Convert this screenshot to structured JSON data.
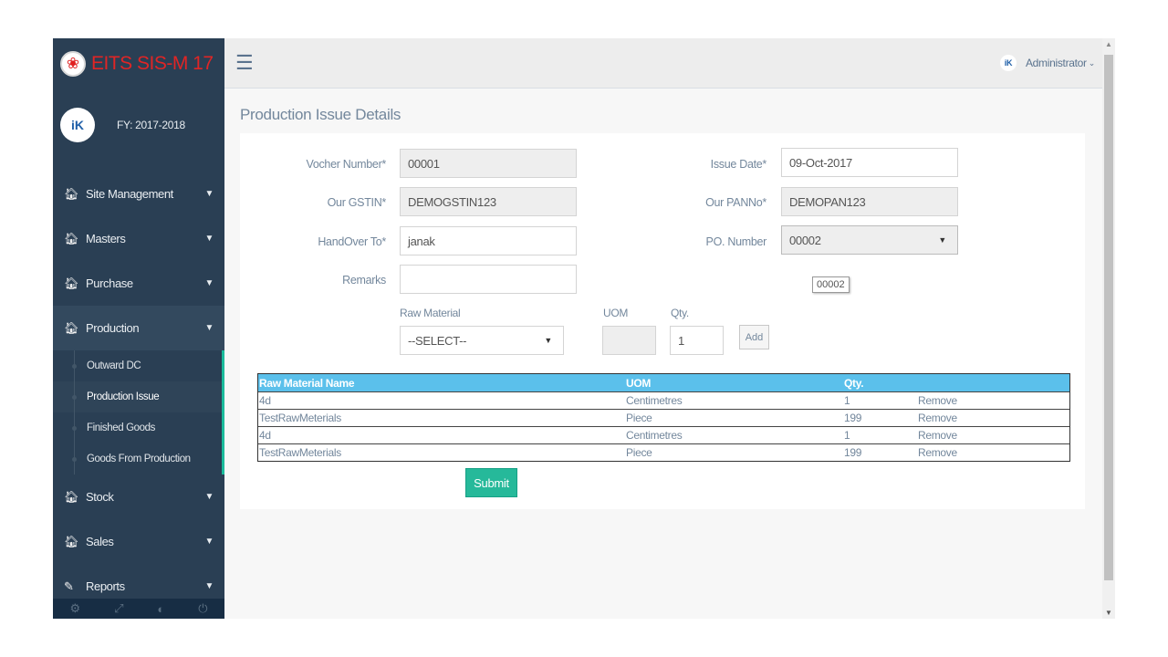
{
  "app": {
    "title": "EITS SIS-M 17",
    "fy": "FY: 2017-2018"
  },
  "topbar": {
    "user": "Administrator"
  },
  "sidebar": {
    "items": [
      {
        "label": "Site Management",
        "icon": "home-icon"
      },
      {
        "label": "Masters",
        "icon": "home-icon"
      },
      {
        "label": "Purchase",
        "icon": "home-icon"
      },
      {
        "label": "Production",
        "icon": "home-icon"
      }
    ],
    "sub_items": [
      "Outward DC",
      "Production Issue",
      "Finished Goods",
      "Goods From Production"
    ],
    "items_after": [
      {
        "label": "Stock",
        "icon": "home-icon"
      },
      {
        "label": "Sales",
        "icon": "home-icon"
      },
      {
        "label": "Reports",
        "icon": "edit-icon"
      }
    ]
  },
  "page": {
    "title": "Production Issue Details"
  },
  "form": {
    "voucher_label": "Vocher Number*",
    "voucher_value": "00001",
    "issue_date_label": "Issue Date*",
    "issue_date_value": "09-Oct-2017",
    "gstin_label": "Our GSTIN*",
    "gstin_value": "DEMOGSTIN123",
    "pan_label": "Our PANNo*",
    "pan_value": "DEMOPAN123",
    "handover_label": "HandOver To*",
    "handover_value": "janak",
    "po_label": "PO. Number",
    "po_value": "00002",
    "po_tooltip": "00002",
    "remarks_label": "Remarks",
    "remarks_value": "",
    "raw_material_label": "Raw Material",
    "raw_material_value": "--SELECT--",
    "uom_label": "UOM",
    "uom_value": "",
    "qty_label": "Qty.",
    "qty_value": "1",
    "add_label": "Add",
    "submit_label": "Submit"
  },
  "table": {
    "headers": [
      "Raw Material Name",
      "UOM",
      "Qty.",
      ""
    ],
    "rows": [
      [
        "4d",
        "Centimetres",
        "1",
        "Remove"
      ],
      [
        "TestRawMeterials",
        "Piece",
        "199",
        "Remove"
      ],
      [
        "4d",
        "Centimetres",
        "1",
        "Remove"
      ],
      [
        "TestRawMeterials",
        "Piece",
        "199",
        "Remove"
      ]
    ]
  },
  "colors": {
    "sidebar": "#2a3f54",
    "accent": "#1abb9c",
    "table_header": "#5bc0eb",
    "submit": "#26b99a",
    "brand": "#e02525"
  }
}
